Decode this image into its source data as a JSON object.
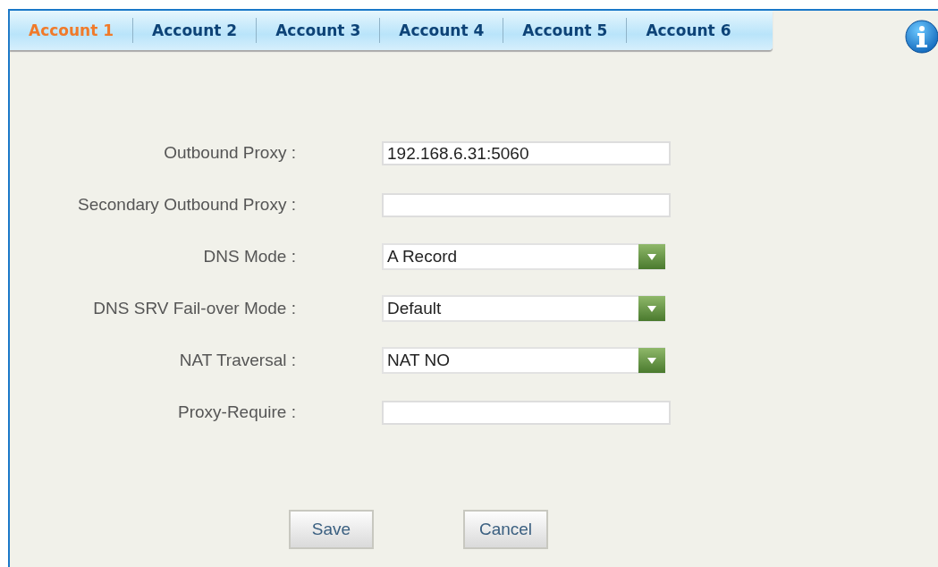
{
  "tabs": [
    {
      "label": "Account 1",
      "selected": true
    },
    {
      "label": "Account 2",
      "selected": false
    },
    {
      "label": "Account 3",
      "selected": false
    },
    {
      "label": "Account 4",
      "selected": false
    },
    {
      "label": "Account 5",
      "selected": false
    },
    {
      "label": "Account 6",
      "selected": false
    }
  ],
  "fields": [
    {
      "label": "Outbound Proxy :",
      "kind": "text",
      "value": "192.168.6.31:5060"
    },
    {
      "label": "Secondary Outbound Proxy :",
      "kind": "text"
    },
    {
      "label": "DNS Mode :",
      "kind": "select",
      "value": "A Record"
    },
    {
      "label": "DNS SRV Fail-over Mode :",
      "kind": "select",
      "value": "Default"
    },
    {
      "label": "NAT Traversal :",
      "kind": "select",
      "value": "NAT NO"
    },
    {
      "label": "Proxy-Require :",
      "kind": "text"
    }
  ],
  "buttons": [
    "Save",
    "Cancel"
  ]
}
